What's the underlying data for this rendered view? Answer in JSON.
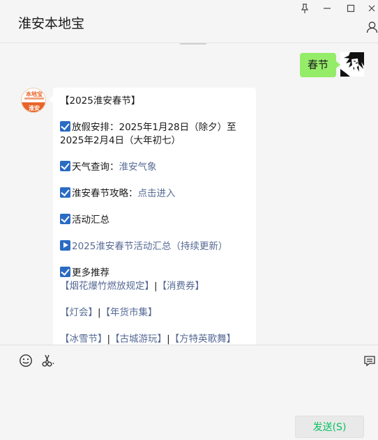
{
  "window": {
    "title": "淮安本地宝",
    "controls": {
      "pin": "⊥",
      "minimize": "—",
      "maximize": "☐",
      "close": "✕"
    }
  },
  "chat": {
    "my_message": "春节",
    "their_avatar_text": {
      "top": "本地宝",
      "bottom": "淮安"
    },
    "their_message": {
      "title": "【2025淮安春节】",
      "holiday_label": "放假安排：",
      "holiday_text_1": "2025年1月28日（除夕）至",
      "holiday_text_2": "2025年2月4日（大年初七）",
      "weather_label": "天气查询：",
      "weather_link": "淮安气象",
      "guide_label": "淮安春节攻略：",
      "guide_link": "点击进入",
      "activities_label": "活动汇总",
      "activities_link": "2025淮安春节活动汇总（持续更新）",
      "more_label": "更多推荐",
      "row1": {
        "a": "【烟花爆竹燃放规定】",
        "sep": "|",
        "b": "【消费券】"
      },
      "row2": {
        "a": "【灯会】",
        "sep": "|",
        "b": "【年货市集】"
      },
      "row3": {
        "a": "【冰雪节】",
        "sep1": "|",
        "b": "【古城游玩】",
        "sep2": "|",
        "c": "【方特英歌舞】"
      }
    }
  },
  "input": {
    "send_label": "发送(S)"
  },
  "colors": {
    "accent_green": "#95ec69",
    "send_text": "#07c160",
    "link": "#576b95",
    "check_blue": "#2a6bc4"
  },
  "icons": [
    "pin-icon",
    "minimize-icon",
    "maximize-icon",
    "close-icon",
    "user-icon",
    "emoji-icon",
    "scissors-icon",
    "chat-history-icon"
  ]
}
